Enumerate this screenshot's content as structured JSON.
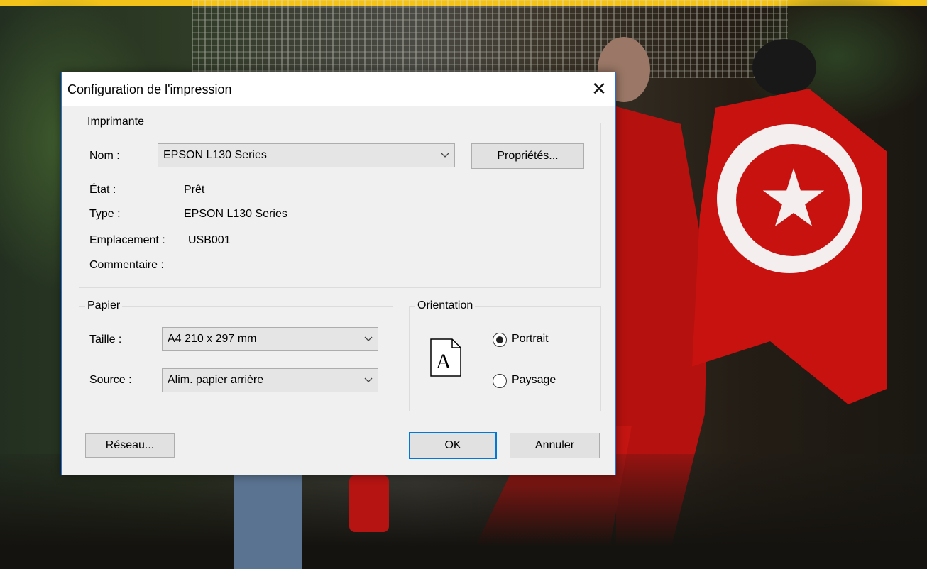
{
  "dialog": {
    "title": "Configuration de l'impression",
    "printer_group": {
      "legend": "Imprimante",
      "name_label": "Nom :",
      "name_value": "EPSON L130 Series",
      "properties_button": "Propriétés...",
      "state_label": "État :",
      "state_value": "Prêt",
      "type_label": "Type :",
      "type_value": "EPSON L130 Series",
      "location_label": "Emplacement :",
      "location_value": "USB001",
      "comment_label": "Commentaire :"
    },
    "paper_group": {
      "legend": "Papier",
      "size_label": "Taille :",
      "size_value": "A4 210 x 297 mm",
      "source_label": "Source :",
      "source_value": "Alim. papier arrière"
    },
    "orientation_group": {
      "legend": "Orientation",
      "page_icon_letter": "A",
      "portrait_label": "Portrait",
      "landscape_label": "Paysage",
      "selected": "Portrait"
    },
    "buttons": {
      "network": "Réseau...",
      "ok": "OK",
      "cancel": "Annuler"
    }
  },
  "icons": {
    "close": "close-icon",
    "dropdown": "chevron-down-icon",
    "page": "portrait-page-icon"
  },
  "colors": {
    "dialog_bg": "#f0f0f0",
    "accent_border": "#0078d7",
    "banner_yellow": "#f2c21a",
    "flag_red": "#c8120f"
  }
}
